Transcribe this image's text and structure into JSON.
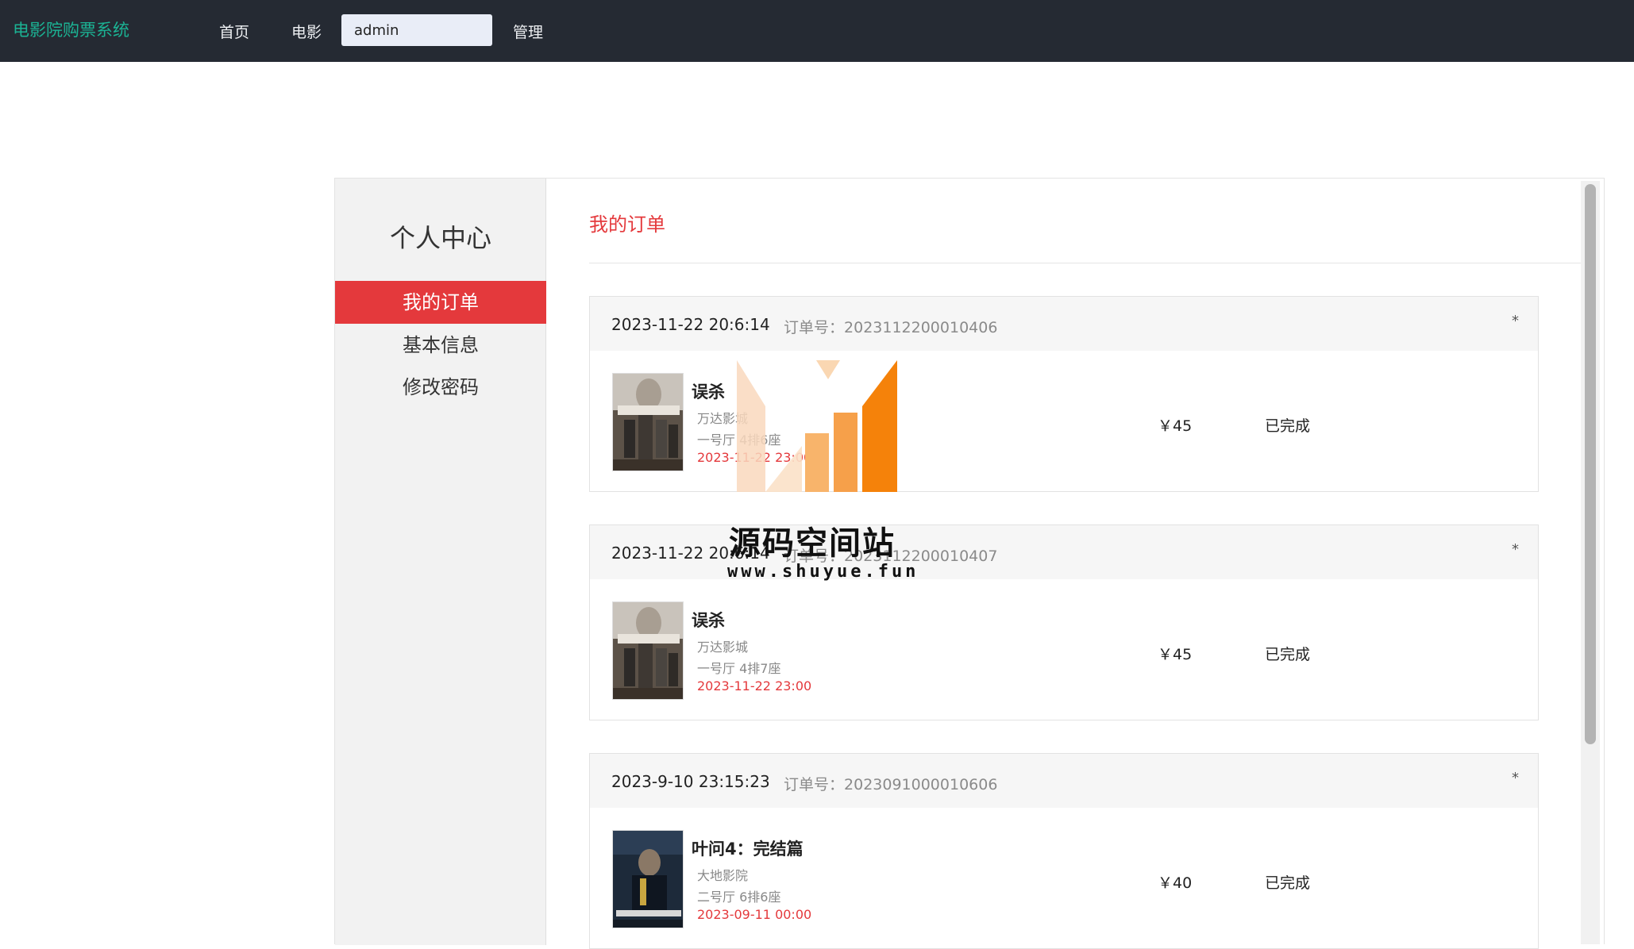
{
  "nav": {
    "brand": "电影院购票系统",
    "home": "首页",
    "movies": "电影",
    "user": "admin",
    "admin": "管理"
  },
  "sidebar": {
    "title": "个人中心",
    "items": [
      {
        "label": "我的订单",
        "active": true
      },
      {
        "label": "基本信息",
        "active": false
      },
      {
        "label": "修改密码",
        "active": false
      }
    ]
  },
  "main": {
    "title": "我的订单",
    "order_no_label": "订单号：",
    "orders": [
      {
        "created": "2023-11-22 20:6:14",
        "order_no": "2023112200010406",
        "delete": "*",
        "movie": "误杀",
        "cinema": "万达影城",
        "seat": "一号厅 4排6座",
        "showtime": "2023-11-22 23:00",
        "price": "￥45",
        "status": "已完成"
      },
      {
        "created": "2023-11-22 20:6:14",
        "order_no": "2023112200010407",
        "delete": "*",
        "movie": "误杀",
        "cinema": "万达影城",
        "seat": "一号厅 4排7座",
        "showtime": "2023-11-22 23:00",
        "price": "￥45",
        "status": "已完成"
      },
      {
        "created": "2023-9-10 23:15:23",
        "order_no": "2023091000010606",
        "delete": "*",
        "movie": "叶问4：完结篇",
        "cinema": "大地影院",
        "seat": "二号厅 6排6座",
        "showtime": "2023-09-11 00:00",
        "price": "￥40",
        "status": "已完成"
      }
    ]
  },
  "watermark": {
    "title": "源码空间站",
    "url": "www.shuyue.fun"
  },
  "colors": {
    "nav_bg": "#252a33",
    "brand": "#1bb394",
    "accent": "#e4393c",
    "watermark_orange": "#f5820a"
  },
  "icons": {
    "poster_0": "movie-poster-image",
    "poster_1": "movie-poster-image",
    "poster_2": "movie-poster-image"
  }
}
